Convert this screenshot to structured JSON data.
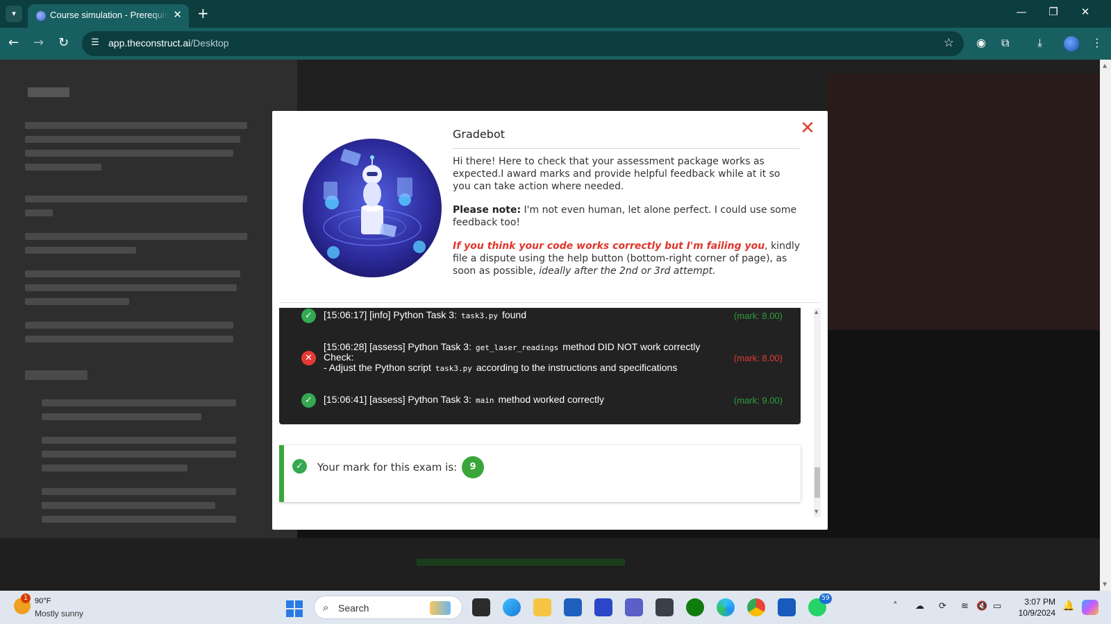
{
  "browser": {
    "tab_title": "Course simulation - Prerequisite",
    "url_host": "app.theconstruct.ai",
    "url_path": "/Desktop"
  },
  "modal": {
    "title": "Gradebot",
    "intro": "Hi there! Here to check that your assessment package works as expected.I award marks and provide helpful feedback while at it so you can take action where needed.",
    "note_label": "Please note:",
    "note_text": " I'm not even human, let alone perfect. I could use some feedback too!",
    "dispute_warning": "If you think your code works correctly but I'm failing you",
    "dispute_text": ", kindly file a dispute using the help button (bottom-right corner of page), as soon as possible, ",
    "dispute_italic": "ideally after the 2nd or 3rd attempt."
  },
  "log": [
    {
      "status": "ok",
      "icon": "check-circle-icon",
      "prefix": "[15:06:17] [info] Python Task 3:",
      "code": "task3.py",
      "suffix": "found",
      "mark": "(mark: 8.00)"
    },
    {
      "status": "fail",
      "icon": "x-circle-icon",
      "prefix": "[15:06:28] [assess] Python Task 3:",
      "code": "get_laser_readings",
      "suffix": "method DID NOT work correctly",
      "check": "Check:",
      "detail_prefix": "- Adjust the Python script",
      "detail_code": "task3.py",
      "detail_suffix": "according to the instructions and specifications",
      "mark": "(mark: 8.00)"
    },
    {
      "status": "ok",
      "icon": "check-circle-icon",
      "prefix": "[15:06:41] [assess] Python Task 3:",
      "code": "main",
      "suffix": "method worked correctly",
      "mark": "(mark: 9.00)"
    }
  ],
  "result": {
    "label": "Your mark for this exam is:",
    "score": "9"
  },
  "taskbar": {
    "temperature": "90°F",
    "condition": "Mostly sunny",
    "weather_badge": "1",
    "search_label": "Search",
    "whatsapp_badge": "59",
    "time": "3:07 PM",
    "date": "10/9/2024"
  },
  "colors": {
    "accent_green": "#3aa63a",
    "error_red": "#e53935",
    "chrome_teal": "#185f61"
  }
}
